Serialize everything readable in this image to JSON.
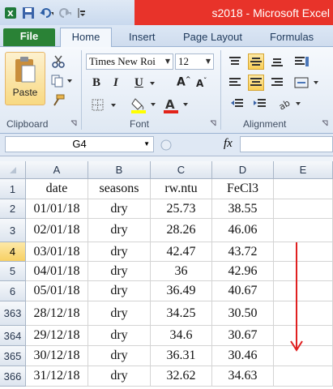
{
  "window": {
    "title": "s2018 - Microsoft Excel"
  },
  "ribbon_tabs": [
    {
      "label": "File"
    },
    {
      "label": "Home"
    },
    {
      "label": "Insert"
    },
    {
      "label": "Page Layout"
    },
    {
      "label": "Formulas"
    }
  ],
  "home": {
    "clipboard": {
      "paste_label": "Paste",
      "group_label": "Clipboard"
    },
    "font": {
      "family": "Times New Roi",
      "size": "12",
      "group_label": "Font"
    },
    "alignment": {
      "group_label": "Alignment"
    }
  },
  "formula_bar": {
    "name_box": "G4",
    "fx_label": "fx",
    "formula": ""
  },
  "sheet": {
    "columns": [
      "A",
      "B",
      "C",
      "D",
      "E"
    ],
    "active_row": "4",
    "rows": [
      {
        "num": "1",
        "cells": [
          "date",
          "seasons",
          "rw.ntu",
          "FeCl3",
          ""
        ]
      },
      {
        "num": "2",
        "cells": [
          "01/01/18",
          "dry",
          "25.73",
          "38.55",
          ""
        ]
      },
      {
        "num": "3",
        "cells": [
          "02/01/18",
          "dry",
          "28.26",
          "46.06",
          ""
        ]
      },
      {
        "num": "4",
        "cells": [
          "03/01/18",
          "dry",
          "42.47",
          "43.72",
          ""
        ]
      },
      {
        "num": "5",
        "cells": [
          "04/01/18",
          "dry",
          "36",
          "42.96",
          ""
        ]
      },
      {
        "num": "6",
        "cells": [
          "05/01/18",
          "dry",
          "36.49",
          "40.67",
          ""
        ]
      },
      {
        "num": "363",
        "cells": [
          "28/12/18",
          "dry",
          "34.25",
          "30.50",
          ""
        ]
      },
      {
        "num": "364",
        "cells": [
          "29/12/18",
          "dry",
          "34.6",
          "30.67",
          ""
        ]
      },
      {
        "num": "365",
        "cells": [
          "30/12/18",
          "dry",
          "36.31",
          "30.46",
          ""
        ]
      },
      {
        "num": "366",
        "cells": [
          "31/12/18",
          "dry",
          "32.62",
          "34.63",
          ""
        ]
      }
    ]
  },
  "annotation": {
    "color": "#e02020"
  }
}
